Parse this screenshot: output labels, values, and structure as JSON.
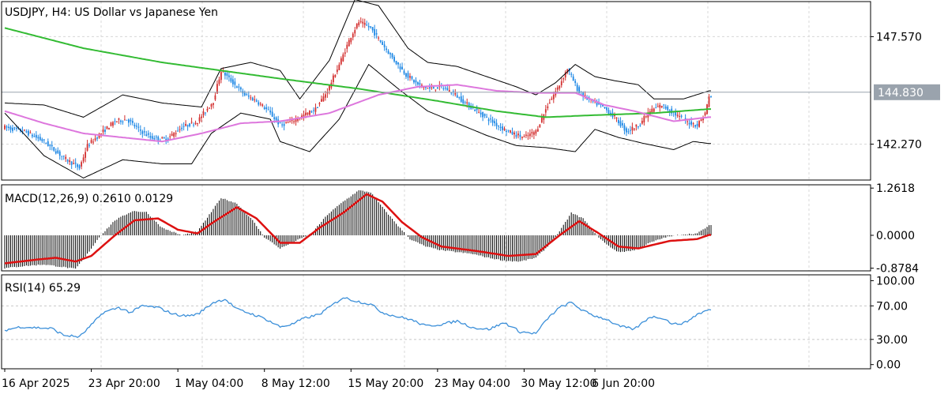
{
  "chart_data": {
    "type": "candlestick",
    "title": "USDJPY, H4:  US Dollar vs Japanese Yen",
    "colors": {
      "bull": "#d32f2f",
      "bear": "#1e88e5",
      "ma_long": "#33bb33",
      "ma_short": "#dd77dd",
      "bands": "#000000",
      "macd_signal": "#dd1111",
      "macd_hist": "#000000",
      "rsi": "#3b8fd9",
      "price_badge": "#9aa3ad"
    },
    "price_panel": {
      "ylim": [
        140.5,
        149.3
      ],
      "ticks": [
        "147.570",
        "142.270"
      ],
      "tick_values": [
        147.57,
        142.27
      ],
      "current_price_label": "144.830",
      "current_price": 144.83,
      "ohlc_anchors": [
        [
          0,
          143.1
        ],
        [
          10,
          142.9
        ],
        [
          20,
          142.4
        ],
        [
          30,
          141.6
        ],
        [
          38,
          141.1
        ],
        [
          42,
          142.2
        ],
        [
          50,
          142.9
        ],
        [
          56,
          143.4
        ],
        [
          62,
          143.5
        ],
        [
          68,
          143.0
        ],
        [
          74,
          142.6
        ],
        [
          82,
          142.5
        ],
        [
          90,
          143.1
        ],
        [
          98,
          143.4
        ],
        [
          106,
          144.4
        ],
        [
          110,
          145.9
        ],
        [
          116,
          145.3
        ],
        [
          122,
          144.7
        ],
        [
          128,
          144.4
        ],
        [
          134,
          143.9
        ],
        [
          140,
          143.2
        ],
        [
          146,
          143.4
        ],
        [
          152,
          143.7
        ],
        [
          158,
          144.0
        ],
        [
          164,
          144.9
        ],
        [
          170,
          146.2
        ],
        [
          176,
          147.6
        ],
        [
          180,
          148.3
        ],
        [
          186,
          148.0
        ],
        [
          192,
          147.2
        ],
        [
          198,
          146.4
        ],
        [
          204,
          145.7
        ],
        [
          210,
          145.2
        ],
        [
          216,
          145.0
        ],
        [
          222,
          145.1
        ],
        [
          228,
          144.8
        ],
        [
          234,
          144.3
        ],
        [
          240,
          143.9
        ],
        [
          246,
          143.5
        ],
        [
          252,
          143.1
        ],
        [
          258,
          142.8
        ],
        [
          264,
          142.6
        ],
        [
          270,
          142.9
        ],
        [
          276,
          144.2
        ],
        [
          282,
          145.2
        ],
        [
          286,
          146.0
        ],
        [
          292,
          144.8
        ],
        [
          298,
          144.4
        ],
        [
          304,
          144.1
        ],
        [
          310,
          143.6
        ],
        [
          316,
          142.9
        ],
        [
          322,
          143.2
        ],
        [
          328,
          143.9
        ],
        [
          334,
          144.2
        ],
        [
          340,
          143.8
        ],
        [
          346,
          143.4
        ],
        [
          352,
          143.2
        ],
        [
          356,
          143.8
        ],
        [
          358,
          144.6
        ]
      ],
      "bands_upper_anchors": [
        [
          0,
          144.3
        ],
        [
          20,
          144.2
        ],
        [
          40,
          143.6
        ],
        [
          60,
          144.7
        ],
        [
          80,
          144.3
        ],
        [
          100,
          144.1
        ],
        [
          110,
          146.0
        ],
        [
          125,
          146.3
        ],
        [
          140,
          145.9
        ],
        [
          150,
          144.5
        ],
        [
          165,
          146.4
        ],
        [
          178,
          149.4
        ],
        [
          190,
          149.1
        ],
        [
          205,
          147.0
        ],
        [
          215,
          146.3
        ],
        [
          230,
          146.1
        ],
        [
          245,
          145.6
        ],
        [
          260,
          145.1
        ],
        [
          270,
          144.7
        ],
        [
          280,
          145.3
        ],
        [
          290,
          146.2
        ],
        [
          300,
          145.6
        ],
        [
          310,
          145.4
        ],
        [
          322,
          145.2
        ],
        [
          330,
          144.5
        ],
        [
          345,
          144.5
        ],
        [
          358,
          144.9
        ]
      ],
      "bands_lower_anchors": [
        [
          0,
          143.8
        ],
        [
          20,
          141.7
        ],
        [
          40,
          140.6
        ],
        [
          60,
          141.5
        ],
        [
          80,
          141.3
        ],
        [
          95,
          141.3
        ],
        [
          105,
          142.8
        ],
        [
          120,
          143.8
        ],
        [
          135,
          143.5
        ],
        [
          140,
          142.4
        ],
        [
          155,
          141.9
        ],
        [
          170,
          143.5
        ],
        [
          185,
          146.2
        ],
        [
          200,
          145.0
        ],
        [
          215,
          143.9
        ],
        [
          230,
          143.3
        ],
        [
          245,
          142.7
        ],
        [
          260,
          142.2
        ],
        [
          275,
          142.1
        ],
        [
          290,
          141.9
        ],
        [
          300,
          143.0
        ],
        [
          312,
          142.6
        ],
        [
          325,
          142.3
        ],
        [
          340,
          142.0
        ],
        [
          350,
          142.4
        ],
        [
          358,
          142.3
        ]
      ],
      "ma_long_anchors": [
        [
          0,
          148.0
        ],
        [
          40,
          147.0
        ],
        [
          80,
          146.3
        ],
        [
          110,
          145.9
        ],
        [
          140,
          145.5
        ],
        [
          180,
          145.0
        ],
        [
          220,
          144.4
        ],
        [
          250,
          143.9
        ],
        [
          275,
          143.6
        ],
        [
          300,
          143.7
        ],
        [
          330,
          143.8
        ],
        [
          358,
          144.0
        ]
      ],
      "ma_short_anchors": [
        [
          0,
          143.9
        ],
        [
          20,
          143.3
        ],
        [
          40,
          142.8
        ],
        [
          60,
          142.6
        ],
        [
          80,
          142.4
        ],
        [
          100,
          142.8
        ],
        [
          120,
          143.3
        ],
        [
          140,
          143.4
        ],
        [
          165,
          143.8
        ],
        [
          190,
          144.7
        ],
        [
          210,
          145.1
        ],
        [
          230,
          145.2
        ],
        [
          250,
          144.9
        ],
        [
          270,
          144.8
        ],
        [
          290,
          144.8
        ],
        [
          305,
          144.2
        ],
        [
          320,
          143.9
        ],
        [
          340,
          143.4
        ],
        [
          358,
          143.6
        ]
      ]
    },
    "macd_panel": {
      "label": "MACD(12,26,9) 0.2610 0.0129",
      "ylim": [
        -0.95,
        1.35
      ],
      "ticks": [
        "1.2618",
        "0.0000",
        "-0.8784"
      ],
      "tick_values": [
        1.2618,
        0.0,
        -0.8784
      ],
      "hist_anchors": [
        [
          0,
          -0.88
        ],
        [
          10,
          -0.82
        ],
        [
          20,
          -0.78
        ],
        [
          30,
          -0.85
        ],
        [
          36,
          -0.9
        ],
        [
          42,
          -0.5
        ],
        [
          48,
          -0.05
        ],
        [
          56,
          0.4
        ],
        [
          65,
          0.65
        ],
        [
          72,
          0.62
        ],
        [
          80,
          0.2
        ],
        [
          90,
          0.0
        ],
        [
          98,
          0.1
        ],
        [
          104,
          0.55
        ],
        [
          110,
          1.0
        ],
        [
          118,
          0.85
        ],
        [
          126,
          0.4
        ],
        [
          132,
          -0.05
        ],
        [
          140,
          -0.35
        ],
        [
          148,
          -0.15
        ],
        [
          156,
          0.05
        ],
        [
          164,
          0.55
        ],
        [
          172,
          0.9
        ],
        [
          180,
          1.2
        ],
        [
          186,
          1.15
        ],
        [
          192,
          0.75
        ],
        [
          200,
          0.25
        ],
        [
          206,
          -0.1
        ],
        [
          214,
          -0.3
        ],
        [
          222,
          -0.4
        ],
        [
          230,
          -0.45
        ],
        [
          238,
          -0.5
        ],
        [
          246,
          -0.6
        ],
        [
          254,
          -0.68
        ],
        [
          262,
          -0.7
        ],
        [
          270,
          -0.6
        ],
        [
          276,
          -0.3
        ],
        [
          282,
          0.1
        ],
        [
          288,
          0.6
        ],
        [
          294,
          0.45
        ],
        [
          300,
          0.05
        ],
        [
          306,
          -0.25
        ],
        [
          312,
          -0.45
        ],
        [
          320,
          -0.4
        ],
        [
          328,
          -0.2
        ],
        [
          336,
          -0.05
        ],
        [
          344,
          0.02
        ],
        [
          352,
          0.05
        ],
        [
          358,
          0.26
        ]
      ],
      "signal_anchors": [
        [
          0,
          -0.75
        ],
        [
          16,
          -0.65
        ],
        [
          26,
          -0.6
        ],
        [
          36,
          -0.7
        ],
        [
          44,
          -0.55
        ],
        [
          56,
          0.0
        ],
        [
          66,
          0.4
        ],
        [
          78,
          0.45
        ],
        [
          88,
          0.15
        ],
        [
          98,
          0.05
        ],
        [
          106,
          0.35
        ],
        [
          118,
          0.75
        ],
        [
          128,
          0.45
        ],
        [
          140,
          -0.2
        ],
        [
          150,
          -0.2
        ],
        [
          160,
          0.2
        ],
        [
          172,
          0.6
        ],
        [
          184,
          1.1
        ],
        [
          192,
          0.9
        ],
        [
          202,
          0.35
        ],
        [
          212,
          -0.05
        ],
        [
          222,
          -0.3
        ],
        [
          240,
          -0.42
        ],
        [
          256,
          -0.55
        ],
        [
          270,
          -0.5
        ],
        [
          282,
          0.0
        ],
        [
          292,
          0.38
        ],
        [
          302,
          0.05
        ],
        [
          312,
          -0.3
        ],
        [
          322,
          -0.35
        ],
        [
          338,
          -0.15
        ],
        [
          352,
          -0.1
        ],
        [
          358,
          0.01
        ]
      ]
    },
    "rsi_panel": {
      "label": "RSI(14) 65.29",
      "ylim": [
        -5,
        107
      ],
      "ticks": [
        "100.00",
        "70.00",
        "30.00",
        "0.00"
      ],
      "tick_values": [
        100,
        70,
        30,
        0
      ],
      "anchors": [
        [
          0,
          41
        ],
        [
          8,
          45
        ],
        [
          16,
          44
        ],
        [
          24,
          43
        ],
        [
          30,
          35
        ],
        [
          38,
          33
        ],
        [
          44,
          47
        ],
        [
          50,
          62
        ],
        [
          58,
          68
        ],
        [
          64,
          62
        ],
        [
          70,
          70
        ],
        [
          78,
          68
        ],
        [
          86,
          60
        ],
        [
          92,
          58
        ],
        [
          98,
          60
        ],
        [
          106,
          74
        ],
        [
          112,
          78
        ],
        [
          118,
          66
        ],
        [
          126,
          60
        ],
        [
          132,
          55
        ],
        [
          140,
          45
        ],
        [
          146,
          48
        ],
        [
          152,
          55
        ],
        [
          160,
          60
        ],
        [
          166,
          70
        ],
        [
          172,
          80
        ],
        [
          178,
          76
        ],
        [
          186,
          72
        ],
        [
          192,
          62
        ],
        [
          198,
          58
        ],
        [
          206,
          54
        ],
        [
          214,
          46
        ],
        [
          222,
          48
        ],
        [
          230,
          52
        ],
        [
          238,
          44
        ],
        [
          246,
          42
        ],
        [
          254,
          50
        ],
        [
          262,
          39
        ],
        [
          270,
          37
        ],
        [
          276,
          55
        ],
        [
          282,
          68
        ],
        [
          288,
          74
        ],
        [
          294,
          64
        ],
        [
          300,
          58
        ],
        [
          306,
          54
        ],
        [
          312,
          46
        ],
        [
          320,
          42
        ],
        [
          328,
          57
        ],
        [
          334,
          56
        ],
        [
          340,
          48
        ],
        [
          346,
          50
        ],
        [
          352,
          60
        ],
        [
          358,
          65.29
        ]
      ]
    },
    "x_axis": {
      "labels": [
        "16 Apr 2025",
        "23 Apr 20:00",
        "1 May 04:00",
        "8 May 12:00",
        "15 May 20:00",
        "23 May 04:00",
        "30 May 12:00",
        "6 Jun 20:00"
      ],
      "label_bars": [
        0,
        44,
        88,
        132,
        176,
        220,
        264,
        300
      ]
    }
  }
}
